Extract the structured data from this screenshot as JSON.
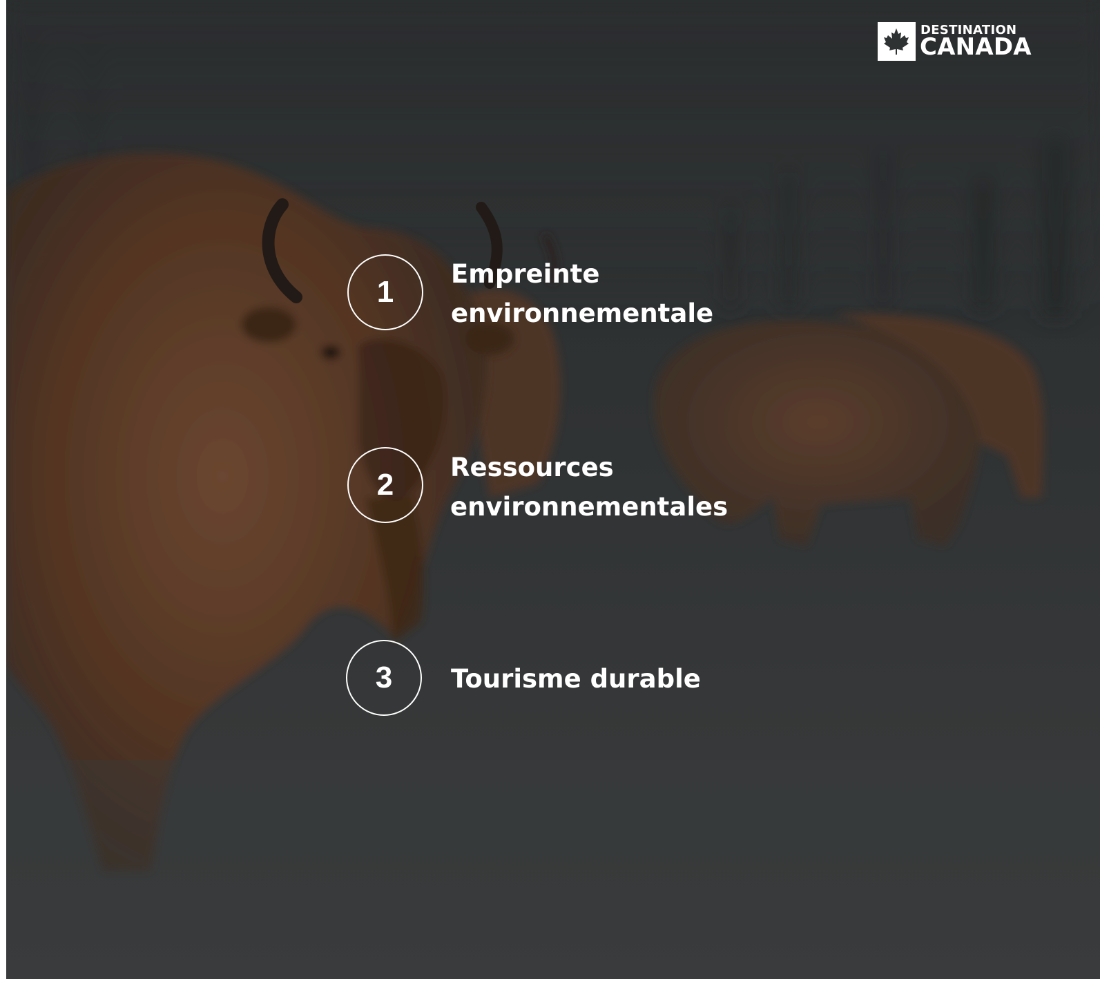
{
  "logo": {
    "line1": "DESTINATION",
    "line2": "CANADA",
    "icon": "maple-leaf-icon"
  },
  "items": [
    {
      "number": "1",
      "line1": "Empreinte",
      "line2": "environnementale"
    },
    {
      "number": "2",
      "line1": "Ressources",
      "line2": "environnementales"
    },
    {
      "number": "3",
      "line1": "Tourisme durable",
      "line2": ""
    }
  ],
  "colors": {
    "overlay": "#2f3233",
    "text": "#ffffff",
    "bison_fur": "#5a3a26"
  }
}
